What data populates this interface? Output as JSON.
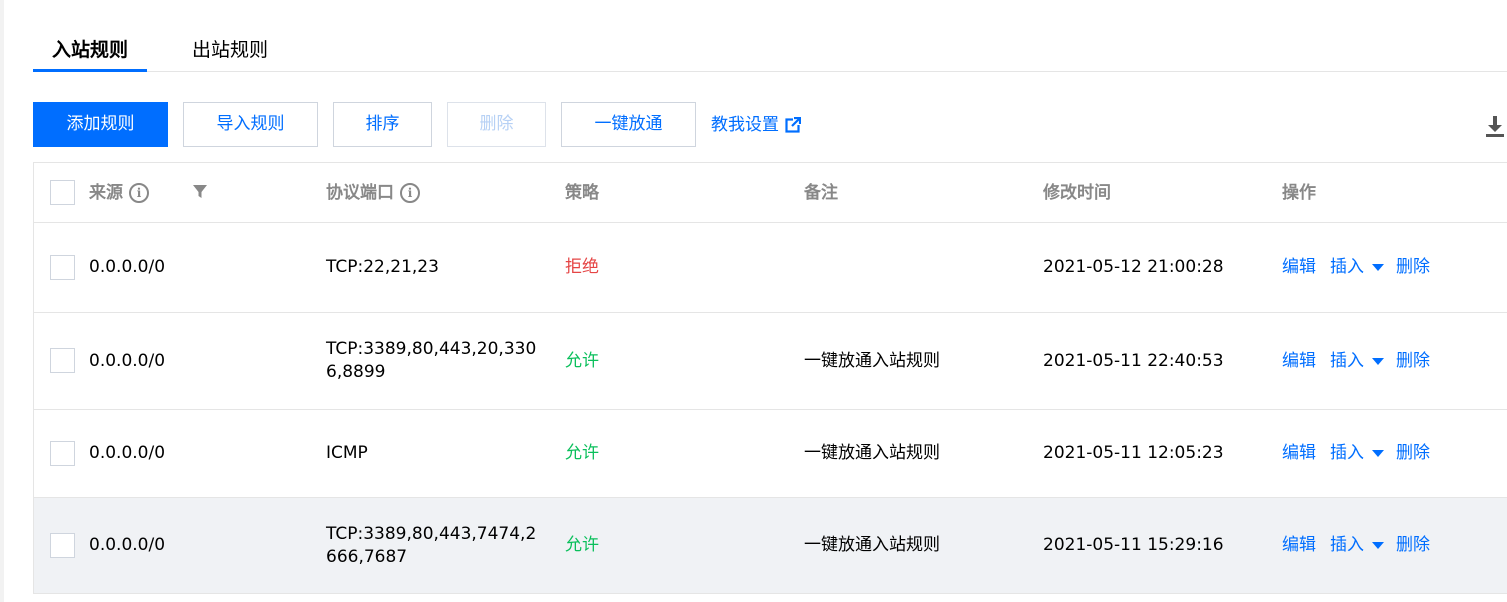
{
  "tabs": [
    {
      "label": "入站规则",
      "active": true
    },
    {
      "label": "出站规则",
      "active": false
    }
  ],
  "toolbar": {
    "add": "添加规则",
    "import": "导入规则",
    "sort": "排序",
    "delete": "删除",
    "open_all": "一键放通",
    "help": "教我设置"
  },
  "table": {
    "headers": {
      "source": "来源",
      "protocol_port": "协议端口",
      "policy": "策略",
      "remark": "备注",
      "modified": "修改时间",
      "actions": "操作"
    },
    "rows": [
      {
        "source": "0.0.0.0/0",
        "protocol_port": "TCP:22,21,23",
        "policy": "拒绝",
        "policy_type": "deny",
        "remark": "",
        "modified": "2021-05-12 21:00:28"
      },
      {
        "source": "0.0.0.0/0",
        "protocol_port": "TCP:3389,80,443,20,3306,8899",
        "policy": "允许",
        "policy_type": "allow",
        "remark": "一键放通入站规则",
        "modified": "2021-05-11 22:40:53"
      },
      {
        "source": "0.0.0.0/0",
        "protocol_port": "ICMP",
        "policy": "允许",
        "policy_type": "allow",
        "remark": "一键放通入站规则",
        "modified": "2021-05-11 12:05:23"
      },
      {
        "source": "0.0.0.0/0",
        "protocol_port": "TCP:3389,80,443,7474,2666,7687",
        "policy": "允许",
        "policy_type": "allow",
        "remark": "一键放通入站规则",
        "modified": "2021-05-11 15:29:16"
      }
    ],
    "row_actions": {
      "edit": "编辑",
      "insert": "插入",
      "delete": "删除"
    }
  },
  "colors": {
    "accent": "#006eff",
    "deny": "#e54545",
    "allow": "#0abf5b"
  },
  "icons": [
    "info-icon",
    "filter-icon",
    "external-link-icon",
    "download-icon",
    "caret-down-icon"
  ]
}
